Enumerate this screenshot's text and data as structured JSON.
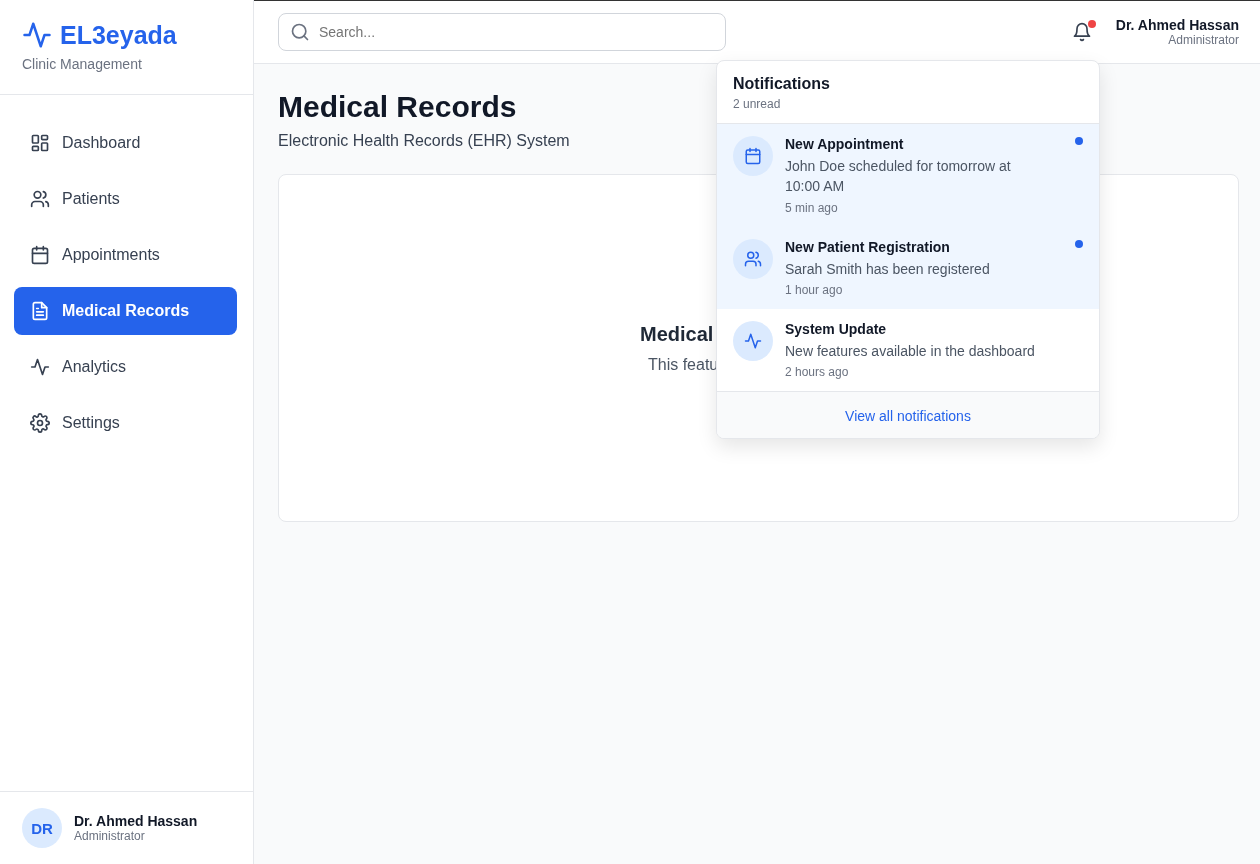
{
  "brand": {
    "name": "EL3eyada",
    "subtitle": "Clinic Management"
  },
  "nav": [
    {
      "label": "Dashboard",
      "kind": "grid",
      "selected": false
    },
    {
      "label": "Patients",
      "kind": "users",
      "selected": false
    },
    {
      "label": "Appointments",
      "kind": "calendar",
      "selected": false
    },
    {
      "label": "Medical Records",
      "kind": "file",
      "selected": true
    },
    {
      "label": "Analytics",
      "kind": "activity",
      "selected": false
    },
    {
      "label": "Settings",
      "kind": "gear",
      "selected": false
    }
  ],
  "sidebar_user": {
    "initials": "DR",
    "name": "Dr. Ahmed Hassan",
    "role": "Administrator"
  },
  "search": {
    "placeholder": "Search..."
  },
  "header_user": {
    "name": "Dr. Ahmed Hassan",
    "role": "Administrator",
    "has_unread": true
  },
  "page": {
    "title": "Medical Records",
    "subtitle": "Electronic Health Records (EHR) System"
  },
  "card": {
    "title": "Medical",
    "text": "This featu"
  },
  "notifications": {
    "title": "Notifications",
    "count": "2 unread",
    "footer": "View all notifications",
    "items": [
      {
        "kind": "calendar",
        "title": "New Appointment",
        "text": "John Doe scheduled for tomorrow at 10:00 AM",
        "time": "5 min ago",
        "unread": true
      },
      {
        "kind": "users",
        "title": "New Patient Registration",
        "text": "Sarah Smith has been registered",
        "time": "1 hour ago",
        "unread": true
      },
      {
        "kind": "activity",
        "title": "System Update",
        "text": "New features available in the dashboard",
        "time": "2 hours ago",
        "unread": false
      }
    ]
  }
}
